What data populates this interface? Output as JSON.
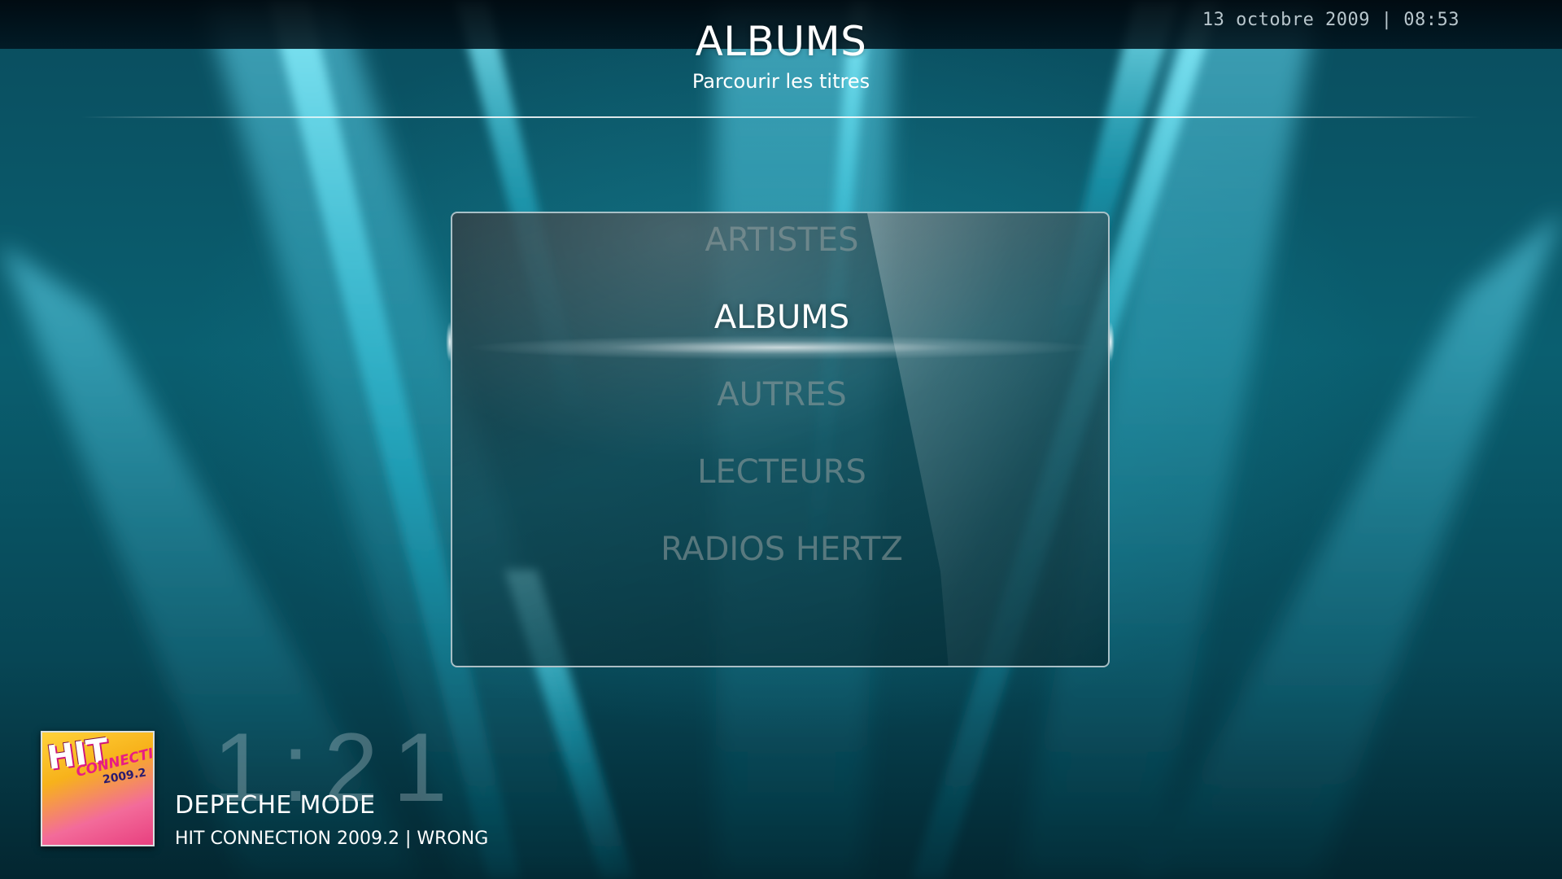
{
  "header": {
    "title": "ALBUMS",
    "subtitle": "Parcourir les titres",
    "datetime": "13 octobre 2009 | 08:53"
  },
  "menu": {
    "items": [
      {
        "label": "ARTISTES",
        "selected": false
      },
      {
        "label": "ALBUMS",
        "selected": true
      },
      {
        "label": "AUTRES",
        "selected": false
      },
      {
        "label": "LECTEURS",
        "selected": false
      },
      {
        "label": "RADIOS HERTZ",
        "selected": false
      }
    ]
  },
  "now_playing": {
    "elapsed": "1:21",
    "artist": "DEPECHE MODE",
    "album_track": "HIT CONNECTION 2009.2 | WRONG",
    "cover": {
      "line1": "HIT",
      "line2": "CONNECTION",
      "line3": "2009.2"
    }
  },
  "colors": {
    "background_top": "#0a4d5e",
    "background_bottom": "#032630",
    "beam": "#2fd6f0",
    "selected_text": "#ffffff",
    "unselected_text": "#96a0a0"
  }
}
